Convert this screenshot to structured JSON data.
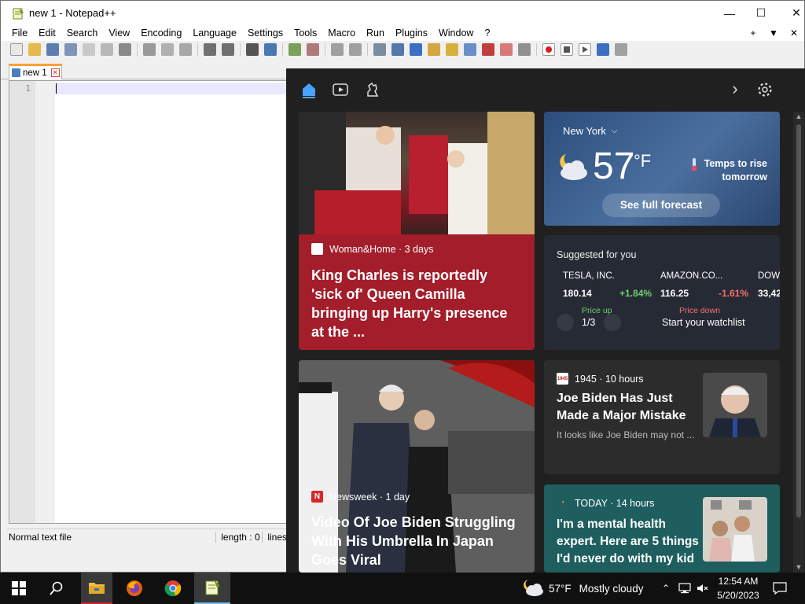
{
  "notepad": {
    "title": "new 1 - Notepad++",
    "window_controls": {
      "minimize": "—",
      "maximize": "☐",
      "close": "✕"
    },
    "menu": [
      "File",
      "Edit",
      "Search",
      "View",
      "Encoding",
      "Language",
      "Settings",
      "Tools",
      "Macro",
      "Run",
      "Plugins",
      "Window",
      "?"
    ],
    "menu_right": [
      "+",
      "▼",
      "✕"
    ],
    "tab": {
      "label": "new 1",
      "close": "✕"
    },
    "editor": {
      "line_numbers": [
        "1"
      ]
    },
    "status": {
      "file_type": "Normal text file",
      "length": "length : 0",
      "lines": "lines"
    }
  },
  "widgets": {
    "nav": {
      "home": "home-icon",
      "video": "video-icon",
      "chess": "chess-icon",
      "next": "›",
      "settings": "gear-icon"
    },
    "news1": {
      "source": "Woman&Home · 3 days",
      "headline": "King Charles is reportedly 'sick of' Queen Camilla bringing up Harry's presence at the ..."
    },
    "weather": {
      "location": "New York",
      "temp": "57",
      "unit": "°F",
      "note": "Temps to rise tomorrow",
      "button": "See full forecast"
    },
    "stocks": {
      "title": "Suggested for you",
      "items": [
        {
          "name": "TESLA, INC.",
          "price": "180.14",
          "change": "+1.84%",
          "label": "Price up"
        },
        {
          "name": "AMAZON.CO...",
          "price": "116.25",
          "change": "-1.61%",
          "label": "Price down"
        },
        {
          "name": "DOW",
          "price": "33,42",
          "change": "",
          "label": ""
        }
      ],
      "pager": "1/3",
      "watchlist": "Start your watchlist"
    },
    "biden": {
      "source": "1945 · 10 hours",
      "logo": "1945",
      "headline": "Joe Biden Has Just Made a Major Mistake",
      "snippet": "It looks like Joe Biden may not ..."
    },
    "news2": {
      "source": "Newsweek · 1 day",
      "logo": "N",
      "headline": "Video Of Joe Biden Struggling With His Umbrella In Japan Goes Viral"
    },
    "today": {
      "source": "TODAY · 14 hours",
      "headline": "I'm a mental health expert. Here are 5 things I'd never do with my kid"
    }
  },
  "taskbar": {
    "weather": {
      "temp": "57°F",
      "condition": "Mostly cloudy"
    },
    "clock": {
      "time": "12:54 AM",
      "date": "5/20/2023"
    }
  },
  "colors": {
    "news1_bg": "#a31d2a",
    "stock_up": "#6fcf6f",
    "stock_down": "#f47171",
    "accent": "#4aa3ff"
  }
}
